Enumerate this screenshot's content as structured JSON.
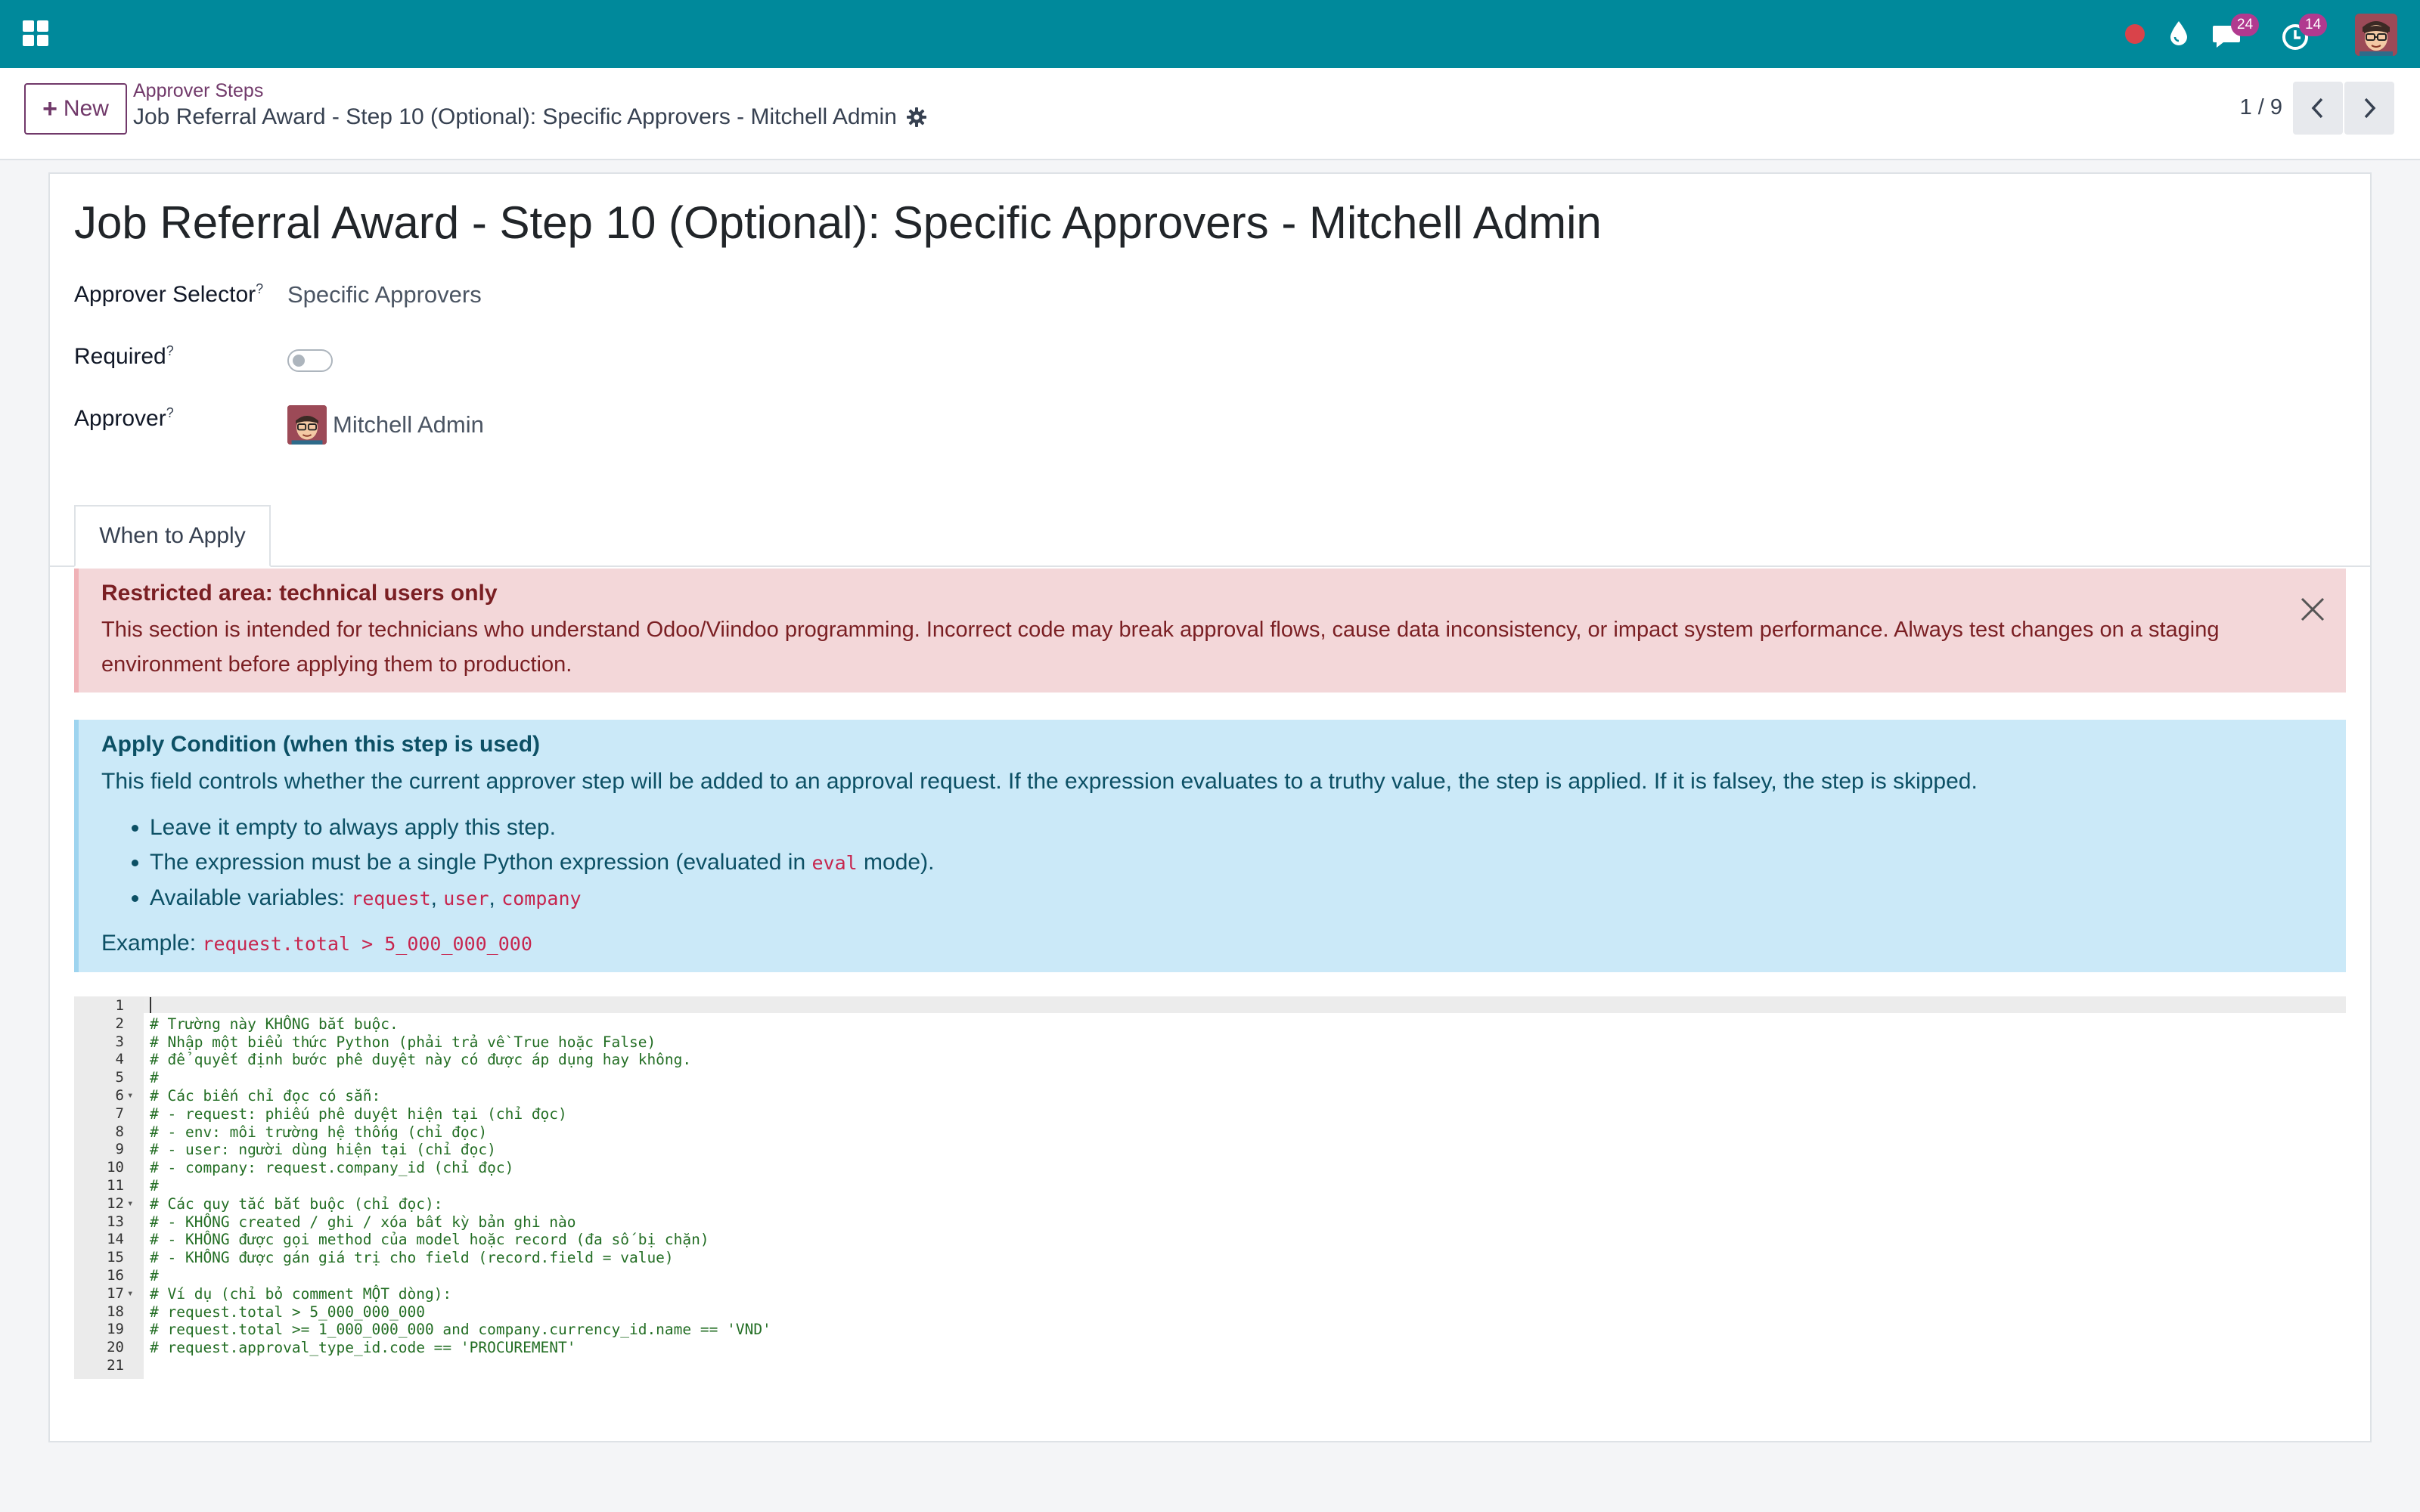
{
  "navbar": {
    "chat_badge": "24",
    "activity_badge": "14",
    "icons": [
      "apps-icon",
      "recording-dot-icon",
      "droplet-icon",
      "chat-icon",
      "clock-icon",
      "user-avatar"
    ]
  },
  "control": {
    "new_label": "New",
    "breadcrumb": "Approver Steps",
    "record_title": "Job Referral Award - Step 10 (Optional): Specific Approvers - Mitchell Admin",
    "pager": "1 / 9"
  },
  "form": {
    "title": "Job Referral Award - Step 10 (Optional): Specific Approvers - Mitchell Admin",
    "approver_selector_label": "Approver Selector",
    "approver_selector_value": "Specific Approvers",
    "required_label": "Required",
    "required_value": false,
    "approver_label": "Approver",
    "approver_value": "Mitchell Admin",
    "help_mark": "?"
  },
  "tabs": [
    {
      "label": "When to Apply",
      "active": true
    }
  ],
  "alert_danger": {
    "title": "Restricted area: technical users only",
    "body": "This section is intended for technicians who understand Odoo/Viindoo programming. Incorrect code may break approval flows, cause data inconsistency, or impact system performance. Always test changes on a staging environment before applying them to production."
  },
  "alert_info": {
    "title": "Apply Condition (when this step is used)",
    "body": "This field controls whether the current approver step will be added to an approval request. If the expression evaluates to a truthy value, the step is applied. If it is falsey, the step is skipped.",
    "bullet1": "Leave it empty to always apply this step.",
    "bullet2_prefix": "The expression must be a single Python expression (evaluated in ",
    "bullet2_code": "eval",
    "bullet2_suffix": " mode).",
    "bullet3_prefix": "Available variables: ",
    "var1": "request",
    "var2": "user",
    "var3": "company",
    "sep": ", ",
    "example_prefix": "Example: ",
    "example_code": "request.total > 5_000_000_000"
  },
  "editor": {
    "lines": [
      "",
      "# Trường này KHÔNG bắt buộc.",
      "# Nhập một biểu thức Python (phải trả về True hoặc False)",
      "# để quyết định bước phê duyệt này có được áp dụng hay không.",
      "#",
      "# Các biến chỉ đọc có sẵn:",
      "# - request: phiếu phê duyệt hiện tại (chỉ đọc)",
      "# - env: môi trường hệ thống (chỉ đọc)",
      "# - user: người dùng hiện tại (chỉ đọc)",
      "# - company: request.company_id (chỉ đọc)",
      "#",
      "# Các quy tắc bắt buộc (chỉ đọc):",
      "# - KHÔNG created / ghi / xóa bất kỳ bản ghi nào",
      "# - KHÔNG được gọi method của model hoặc record (đa số bị chặn)",
      "# - KHÔNG được gán giá trị cho field (record.field = value)",
      "#",
      "# Ví dụ (chỉ bỏ comment MỘT dòng):",
      "# request.total > 5_000_000_000",
      "# request.total >= 1_000_000_000 and company.currency_id.name == 'VND'",
      "# request.approval_type_id.code == 'PROCUREMENT'",
      ""
    ],
    "fold_lines": [
      6,
      12,
      17
    ]
  }
}
